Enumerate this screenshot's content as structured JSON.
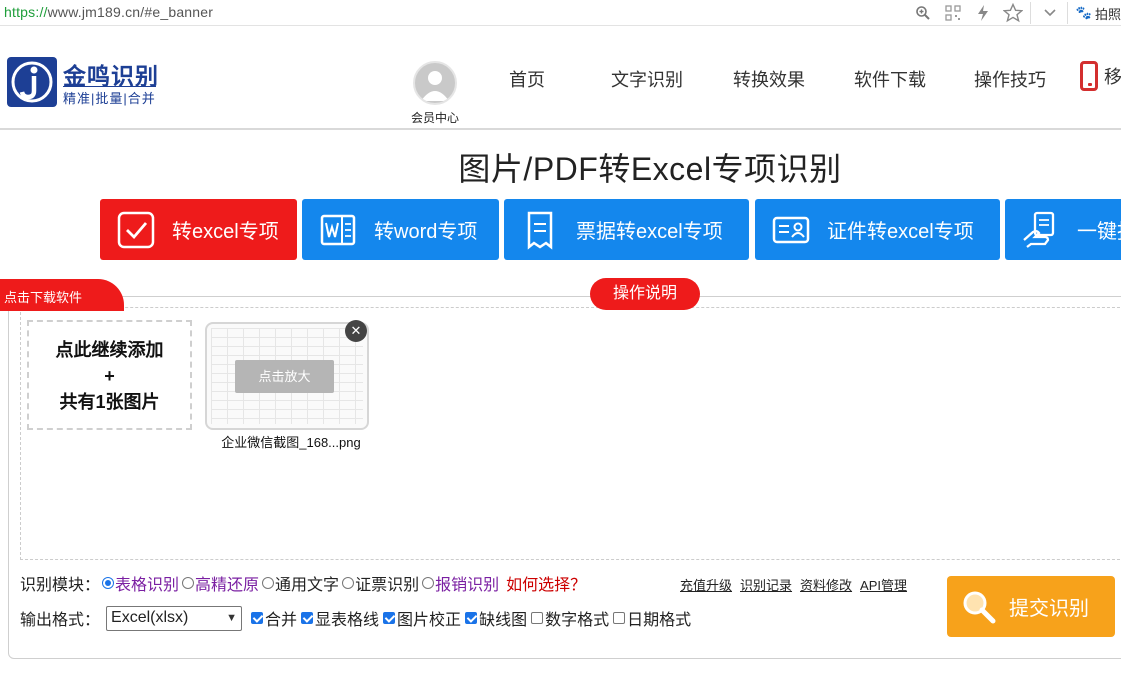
{
  "browser": {
    "url_scheme": "https://",
    "url_rest": "www.jm189.cn/#e_banner",
    "extension_label": "拍照",
    "icons": [
      "zoom-icon",
      "qr-icon",
      "lightning-icon",
      "star-icon",
      "chevron-down-icon",
      "paw-icon"
    ]
  },
  "header": {
    "logo_title": "金鸣识别",
    "logo_sub": "精准|批量|合并",
    "member_label": "会员中心",
    "nav": [
      "首页",
      "文字识别",
      "转换效果",
      "软件下载",
      "操作技巧",
      "移"
    ]
  },
  "page_title": "图片/PDF转Excel专项识别",
  "modes": [
    {
      "label": "转excel专项",
      "icon": "check-square-icon",
      "active": true
    },
    {
      "label": "转word专项",
      "icon": "word-icon",
      "active": false
    },
    {
      "label": "票据转excel专项",
      "icon": "ticket-icon",
      "active": false
    },
    {
      "label": "证件转excel专项",
      "icon": "id-card-icon",
      "active": false
    },
    {
      "label": "一键报",
      "icon": "hand-doc-icon",
      "active": false
    }
  ],
  "panel": {
    "download_tab": "点击下载软件",
    "howto_tab": "操作说明",
    "add_line1": "点此继续添加",
    "add_line2": "+",
    "add_line3": "共有1张图片",
    "thumb_zoom": "点击放大",
    "file_name": "企业微信截图_168...png"
  },
  "options": {
    "module_label": "识别模块：",
    "modules": [
      {
        "label": "表格识别",
        "selected": true,
        "style": "purple"
      },
      {
        "label": "高精还原",
        "selected": false,
        "style": "purple"
      },
      {
        "label": "通用文字",
        "selected": false,
        "style": "dark"
      },
      {
        "label": "证票识别",
        "selected": false,
        "style": "dark"
      },
      {
        "label": "报销识别",
        "selected": false,
        "style": "purple"
      }
    ],
    "howto_choose": "如何选择？",
    "links": [
      "充值升级",
      "识别记录",
      "资料修改",
      "API管理"
    ],
    "format_label": "输出格式：",
    "format_value": "Excel(xlsx)",
    "checks": [
      {
        "label": "合并",
        "checked": true
      },
      {
        "label": "显表格线",
        "checked": true
      },
      {
        "label": "图片校正",
        "checked": true
      },
      {
        "label": "缺线图",
        "checked": true
      },
      {
        "label": "数字格式",
        "checked": false
      },
      {
        "label": "日期格式",
        "checked": false
      }
    ],
    "submit_label": "提交识别"
  },
  "colors": {
    "red": "#ee1b1b",
    "blue": "#1487ed",
    "orange": "#f7a21b",
    "brand": "#1d3f95"
  }
}
